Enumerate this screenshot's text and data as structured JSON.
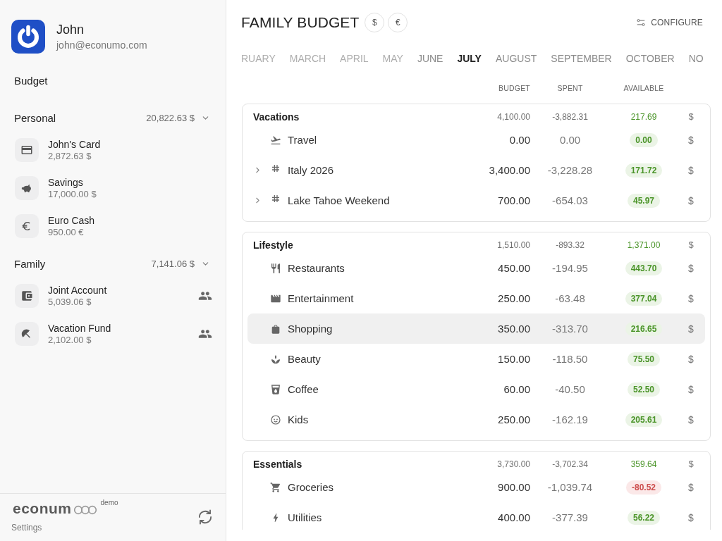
{
  "sidebar": {
    "user": {
      "name": "John",
      "email": "john@econumo.com"
    },
    "nav": [
      {
        "label": "Budget"
      }
    ],
    "account_groups": [
      {
        "name": "Personal",
        "total": "20,822.63 $",
        "expanded": true,
        "accounts": [
          {
            "name": "John's Card",
            "balance": "2,872.63 $",
            "shared": false
          },
          {
            "name": "Savings",
            "balance": "17,000.00 $",
            "shared": false
          },
          {
            "name": "Euro Cash",
            "balance": "950.00 €",
            "shared": false
          }
        ]
      },
      {
        "name": "Family",
        "total": "7,141.06 $",
        "expanded": true,
        "accounts": [
          {
            "name": "Joint Account",
            "balance": "5,039.06 $",
            "shared": true
          },
          {
            "name": "Vacation Fund",
            "balance": "2,102.00 $",
            "shared": true
          }
        ]
      }
    ],
    "footer": {
      "logo": "econum",
      "badge": "demo",
      "settings": "Settings"
    }
  },
  "header": {
    "title": "FAMILY BUDGET",
    "currencies": [
      "$",
      "€"
    ],
    "configure": "CONFIGURE"
  },
  "months": [
    {
      "label": "RUARY",
      "selected": false,
      "dimmed": true
    },
    {
      "label": "MARCH",
      "selected": false,
      "dimmed": true
    },
    {
      "label": "APRIL",
      "selected": false,
      "dimmed": true
    },
    {
      "label": "MAY",
      "selected": false,
      "dimmed": true
    },
    {
      "label": "JUNE",
      "selected": false,
      "dimmed": false
    },
    {
      "label": "JULY",
      "selected": true,
      "dimmed": false
    },
    {
      "label": "AUGUST",
      "selected": false,
      "dimmed": false
    },
    {
      "label": "SEPTEMBER",
      "selected": false,
      "dimmed": false
    },
    {
      "label": "OCTOBER",
      "selected": false,
      "dimmed": false
    },
    {
      "label": "NO",
      "selected": false,
      "dimmed": false
    }
  ],
  "budget_table": {
    "columns": [
      "BUDGET",
      "SPENT",
      "AVAILABLE"
    ],
    "groups": [
      {
        "name": "Vacations",
        "budget": "4,100.00",
        "spent": "-3,882.31",
        "available": "217.69",
        "currency": "$",
        "overspent": false,
        "rows": [
          {
            "kind": "category",
            "name": "Travel",
            "budget": "0.00",
            "spent": "0.00",
            "available": "0.00",
            "currency": "$",
            "overspent": false,
            "highlighted": false
          },
          {
            "kind": "tag",
            "expanded": false,
            "name": "Italy 2026",
            "budget": "3,400.00",
            "spent": "-3,228.28",
            "available": "171.72",
            "currency": "$",
            "overspent": false,
            "highlighted": false
          },
          {
            "kind": "tag",
            "expanded": false,
            "name": "Lake Tahoe Weekend",
            "budget": "700.00",
            "spent": "-654.03",
            "available": "45.97",
            "currency": "$",
            "overspent": false,
            "highlighted": false
          }
        ]
      },
      {
        "name": "Lifestyle",
        "budget": "1,510.00",
        "spent": "-893.32",
        "available": "1,371.00",
        "currency": "$",
        "overspent": false,
        "rows": [
          {
            "kind": "category",
            "name": "Restaurants",
            "budget": "450.00",
            "spent": "-194.95",
            "available": "443.70",
            "currency": "$",
            "overspent": false,
            "highlighted": false
          },
          {
            "kind": "category",
            "name": "Entertainment",
            "budget": "250.00",
            "spent": "-63.48",
            "available": "377.04",
            "currency": "$",
            "overspent": false,
            "highlighted": false
          },
          {
            "kind": "category",
            "name": "Shopping",
            "budget": "350.00",
            "spent": "-313.70",
            "available": "216.65",
            "currency": "$",
            "overspent": false,
            "highlighted": true
          },
          {
            "kind": "category",
            "name": "Beauty",
            "budget": "150.00",
            "spent": "-118.50",
            "available": "75.50",
            "currency": "$",
            "overspent": false,
            "highlighted": false
          },
          {
            "kind": "category",
            "name": "Coffee",
            "budget": "60.00",
            "spent": "-40.50",
            "available": "52.50",
            "currency": "$",
            "overspent": false,
            "highlighted": false
          },
          {
            "kind": "category",
            "name": "Kids",
            "budget": "250.00",
            "spent": "-162.19",
            "available": "205.61",
            "currency": "$",
            "overspent": false,
            "highlighted": false
          }
        ]
      },
      {
        "name": "Essentials",
        "budget": "3,730.00",
        "spent": "-3,702.34",
        "available": "359.64",
        "currency": "$",
        "overspent": false,
        "rows": [
          {
            "kind": "category",
            "name": "Groceries",
            "budget": "900.00",
            "spent": "-1,039.74",
            "available": "-80.52",
            "currency": "$",
            "overspent": true,
            "highlighted": false
          },
          {
            "kind": "category",
            "name": "Utilities",
            "budget": "400.00",
            "spent": "-377.39",
            "available": "56.22",
            "currency": "$",
            "overspent": false,
            "highlighted": false
          }
        ]
      }
    ]
  }
}
